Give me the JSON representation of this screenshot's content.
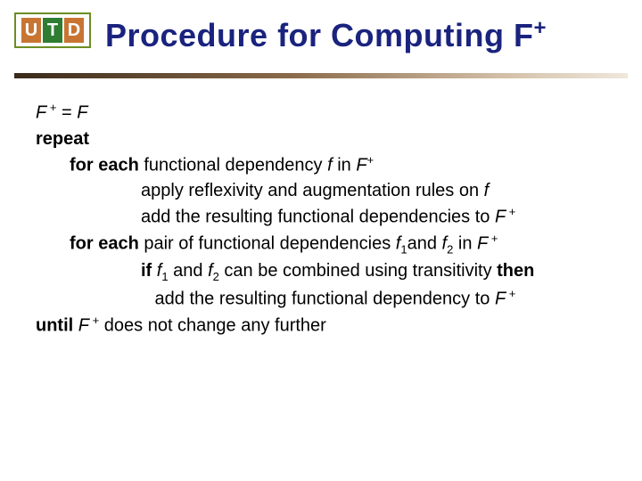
{
  "logo": {
    "u": "U",
    "t": "T",
    "d": "D"
  },
  "title": {
    "text": "Procedure for Computing F",
    "sup": "+"
  },
  "algo": {
    "l1_F": "F",
    "l1_plus": " +",
    "l1_eq": " = ",
    "l1_F2": "F",
    "l2_repeat": "repeat",
    "l3_foreach": "for each",
    "l3_rest1": " functional dependency ",
    "l3_f": "f",
    "l3_rest2": " in ",
    "l3_Fp": "F",
    "l3_sup": "+",
    "l4_a": "apply reflexivity and augmentation rules on ",
    "l4_f": "f",
    "l5_a": "add the resulting functional dependencies to ",
    "l5_F": "F",
    "l5_sup": " +",
    "l6_foreach": "for each",
    "l6_a": " pair of functional dependencies ",
    "l6_f1": "f",
    "l6_s1": "1",
    "l6_and": "and ",
    "l6_f2": "f",
    "l6_s2": "2",
    "l6_in": " in ",
    "l6_F": "F",
    "l6_sup": " +",
    "l7_if": "if",
    "l7_sp": " ",
    "l7_f1": "f",
    "l7_s1": "1",
    "l7_and": " and ",
    "l7_f2": "f",
    "l7_s2": "2",
    "l7_rest": " can be combined using transitivity ",
    "l7_then": "then",
    "l8_a": " add the resulting functional dependency to ",
    "l8_F": "F",
    "l8_sup": " +",
    "l9_until": "until",
    "l9_sp": " ",
    "l9_F": "F",
    "l9_sup": " +",
    "l9_rest": " does not change any further"
  }
}
